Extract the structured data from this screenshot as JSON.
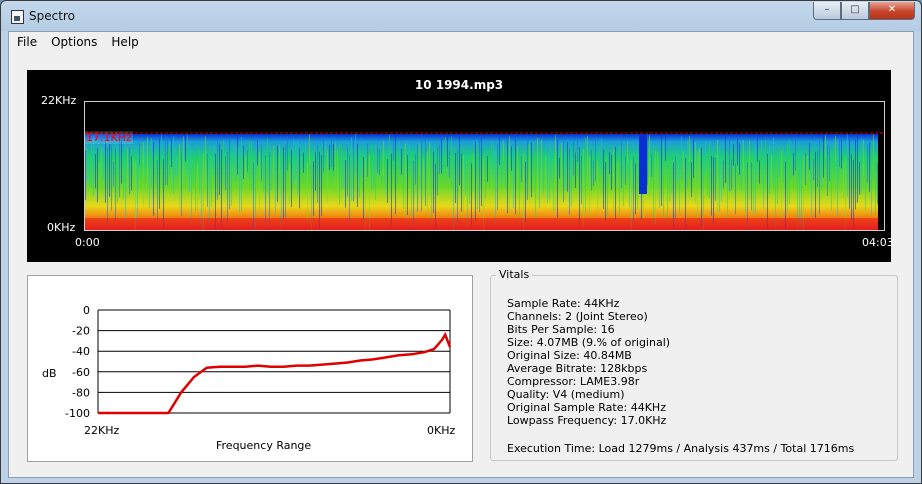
{
  "window": {
    "title": "Spectro",
    "min_glyph": "–",
    "max_glyph": "□",
    "close_glyph": "✕"
  },
  "menu": [
    "File",
    "Options",
    "Help"
  ],
  "spectrogram": {
    "title": "10 1994.mp3",
    "freq_top_label": "22KHz",
    "freq_bottom_label": "0KHz",
    "lowpass_label": "17.1KHz",
    "time_start": "0:00",
    "time_end": "04:03"
  },
  "frequency_graph": {
    "ylabel": "dB",
    "xlabel": "Frequency Range",
    "x_left_label": "22KHz",
    "x_right_label": "0KHz",
    "y_ticks": [
      "0",
      "-20",
      "-40",
      "-60",
      "-80",
      "-100"
    ]
  },
  "chart_data": {
    "type": "line",
    "title": "",
    "xlabel": "Frequency Range",
    "ylabel": "dB",
    "x_unit": "KHz",
    "x_reversed": true,
    "x": [
      22,
      17.6,
      16.8,
      16.0,
      15.2,
      14.4,
      13.6,
      12.8,
      12.0,
      11.2,
      10.4,
      9.6,
      8.8,
      8.0,
      7.2,
      6.4,
      5.6,
      4.8,
      4.0,
      3.2,
      2.4,
      1.6,
      1.0,
      0.5,
      0.3,
      0
    ],
    "series": [
      {
        "color": "#e00000",
        "values": [
          -100,
          -100,
          -80,
          -65,
          -56,
          -55,
          -55,
          -55,
          -54,
          -55,
          -55,
          -54,
          -54,
          -53,
          -52,
          -51,
          -49,
          -48,
          -46,
          -44,
          -43,
          -41,
          -38,
          -29,
          -24,
          -36
        ]
      }
    ],
    "ylim": [
      -100,
      0
    ],
    "y_ticks": [
      0,
      -20,
      -40,
      -60,
      -80,
      -100
    ],
    "grid": true
  },
  "vitals": {
    "legend": "Vitals",
    "lines": [
      "Sample Rate: 44KHz",
      "Channels: 2 (Joint Stereo)",
      "Bits Per Sample: 16",
      "Size: 4.07MB (9.% of original)",
      "Original Size: 40.84MB",
      "Average Bitrate: 128kbps",
      "Compressor: LAME3.98r",
      "Quality: V4 (medium)",
      "Original Sample Rate: 44KHz",
      "Lowpass Frequency: 17.0KHz"
    ],
    "execution": "Execution Time: Load 1279ms / Analysis 437ms / Total 1716ms"
  }
}
